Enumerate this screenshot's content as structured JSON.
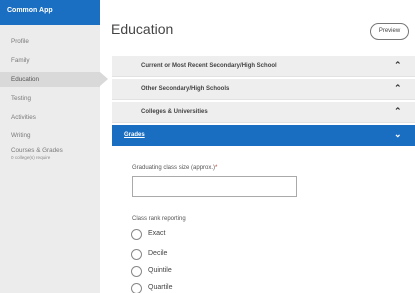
{
  "sidebar": {
    "brand": "Common App",
    "items": [
      {
        "label": "Profile"
      },
      {
        "label": "Family"
      },
      {
        "label": "Education"
      },
      {
        "label": "Testing"
      },
      {
        "label": "Activities"
      },
      {
        "label": "Writing"
      },
      {
        "label": "Courses & Grades",
        "sub": "0 college(s) require"
      }
    ],
    "active_item": "Education"
  },
  "header": {
    "title": "Education",
    "preview_label": "Preview"
  },
  "sections": [
    {
      "label": "Current or Most Recent Secondary/High School",
      "state": "collapsed"
    },
    {
      "label": "Other Secondary/High Schools",
      "state": "collapsed"
    },
    {
      "label": "Colleges & Universities",
      "state": "collapsed"
    },
    {
      "label": "Grades",
      "state": "open"
    }
  ],
  "form": {
    "class_size_label": "Graduating class size (approx.)",
    "required_mark": "*",
    "class_size_value": "",
    "class_rank_label": "Class rank reporting",
    "rank_options": [
      "Exact",
      "Decile",
      "Quintile",
      "Quartile"
    ]
  },
  "icons": {
    "collapsed_chevron": "chevron-up-icon",
    "open_chevron": "chevron-down-icon",
    "active_arrow": "active-pointer"
  },
  "colors": {
    "brand": "#1b6fc2",
    "open_section": "#1a6ec2",
    "sidebar_bg": "#ececec",
    "required": "#c0392b"
  }
}
